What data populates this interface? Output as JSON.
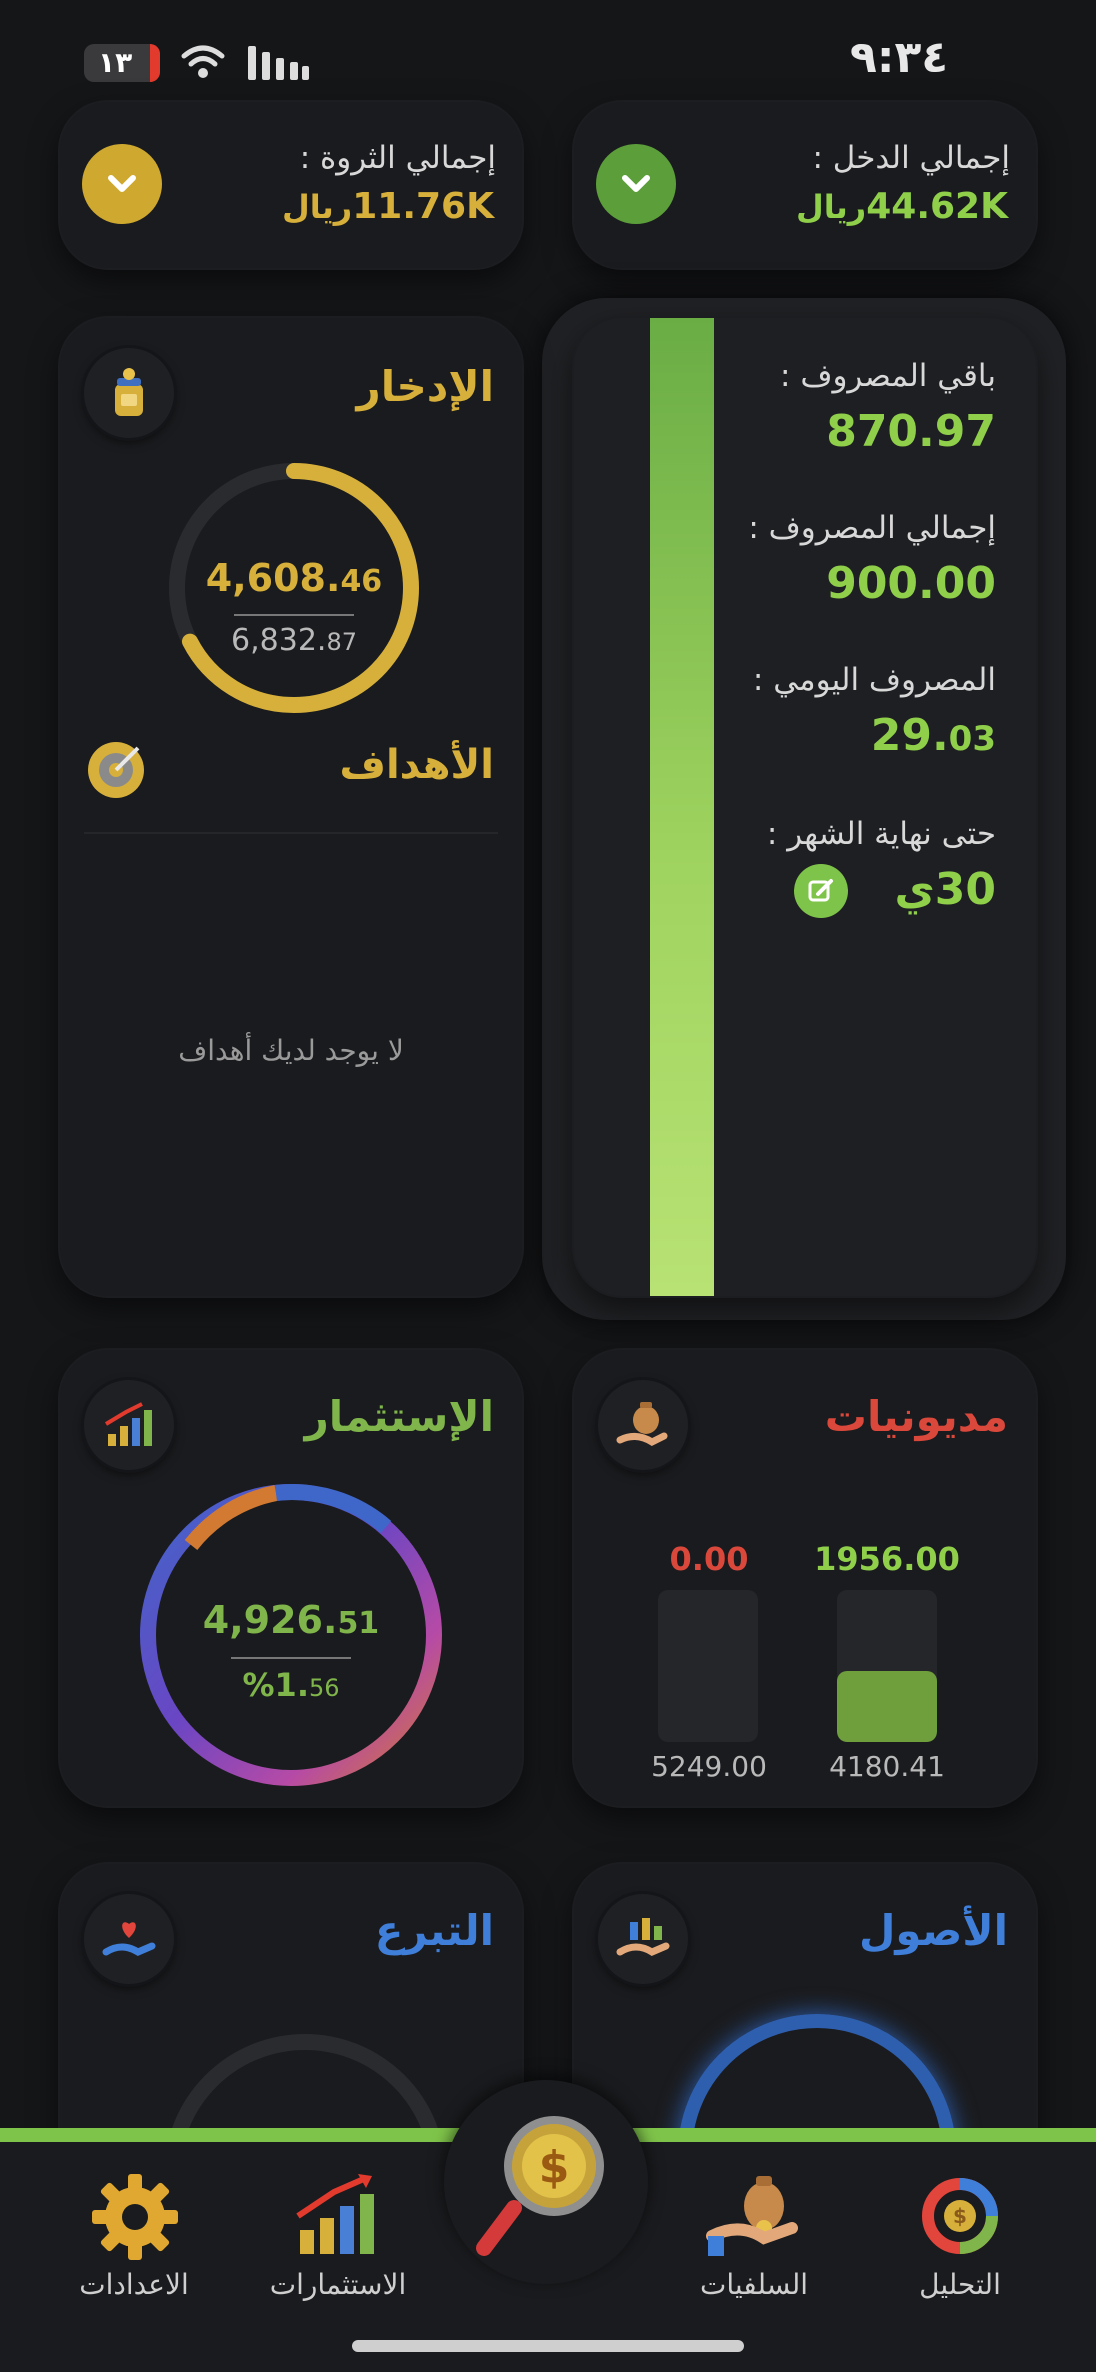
{
  "status_bar": {
    "time": "٩:٣٤",
    "battery": "١٣"
  },
  "top": {
    "income_label": "إجمالي الدخل :",
    "income_value": "44.62K",
    "income_currency": "ريال",
    "wealth_label": "إجمالي الثروة :",
    "wealth_value": "11.76K",
    "wealth_currency": "ريال"
  },
  "budget": {
    "remaining_label": "باقي المصروف :",
    "remaining_value": "870.97",
    "total_label": "إجمالي المصروف :",
    "total_value": "900.00",
    "daily_label": "المصروف اليومي :",
    "daily_int": "29.",
    "daily_dec": "03",
    "month_end_label": "حتى نهاية الشهر :",
    "month_end_value": "30ي"
  },
  "savings": {
    "title": "الإدخار",
    "current_int": "4,608.",
    "current_dec": "46",
    "target_int": "6,832.",
    "target_dec": "87",
    "progress": 0.674
  },
  "goals": {
    "title": "الأهداف",
    "empty_text": "لا يوجد لديك أهداف"
  },
  "investment": {
    "title": "الإستثمار",
    "value_int": "4,926.",
    "value_dec": "51",
    "pct_int": "%1.",
    "pct_dec": "56"
  },
  "debts": {
    "title": "مديونيات",
    "bar1_top": "1956.00",
    "bar1_bottom": "4180.41",
    "bar1_fill": 0.468,
    "bar2_top": "0.00",
    "bar2_bottom": "5249.00",
    "bar2_fill": 0
  },
  "donation": {
    "title": "التبرع"
  },
  "assets": {
    "title": "الأصول"
  },
  "nav": {
    "analysis": "التحليل",
    "loans": "السلفيات",
    "investments": "الاستثمارات",
    "settings": "الاعدادات"
  },
  "colors": {
    "green": "#8fcf4a",
    "gold": "#d6b03a",
    "red": "#d9483b",
    "blue": "#3f7fd9",
    "investment_green": "#7fb54a"
  }
}
